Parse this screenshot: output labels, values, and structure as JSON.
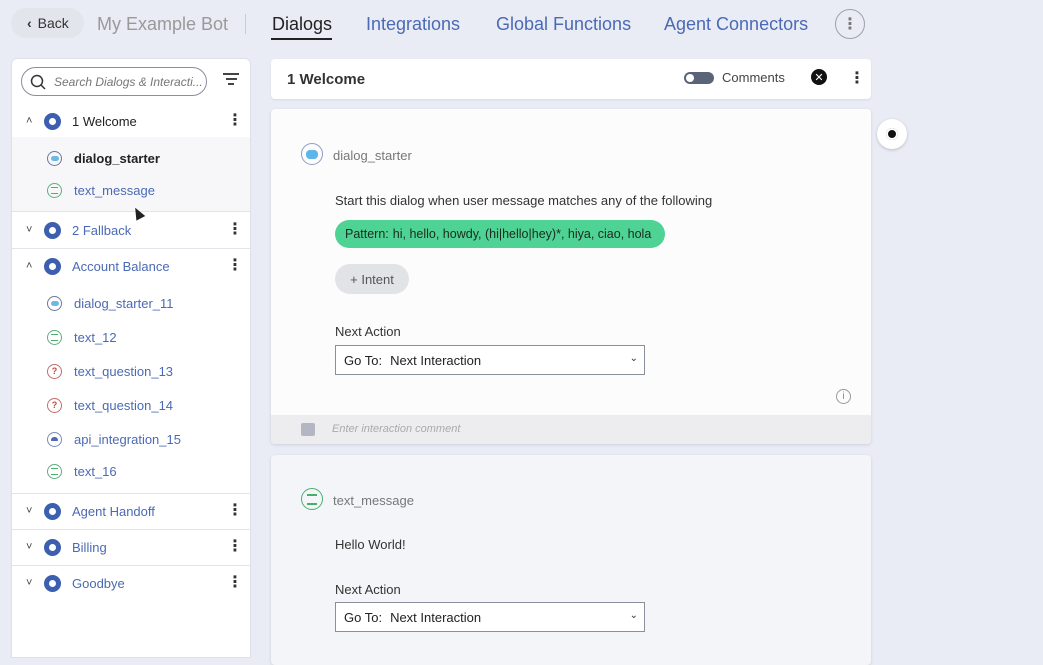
{
  "topbar": {
    "back_label": "Back",
    "bot_name": "My Example Bot",
    "tabs": [
      {
        "label": "Dialogs",
        "active": true
      },
      {
        "label": "Integrations"
      },
      {
        "label": "Global Functions"
      },
      {
        "label": "Agent Connectors"
      }
    ]
  },
  "sidebar": {
    "search_placeholder": "Search Dialogs & Interacti...",
    "groups": [
      {
        "label": "1 Welcome",
        "expanded": true,
        "selected": true,
        "items": [
          {
            "label": "dialog_starter",
            "icon": "starter-icon",
            "selected": true
          },
          {
            "label": "text_message",
            "icon": "text-icon"
          }
        ]
      },
      {
        "label": "2 Fallback",
        "expanded": false
      },
      {
        "label": "Account Balance",
        "expanded": true,
        "items": [
          {
            "label": "dialog_starter_11",
            "icon": "starter-icon"
          },
          {
            "label": "text_12",
            "icon": "text-icon"
          },
          {
            "label": "text_question_13",
            "icon": "question-icon"
          },
          {
            "label": "text_question_14",
            "icon": "question-icon"
          },
          {
            "label": "api_integration_15",
            "icon": "cloud-icon"
          },
          {
            "label": "text_16",
            "icon": "text-icon"
          }
        ]
      },
      {
        "label": "Agent Handoff",
        "expanded": false
      },
      {
        "label": "Billing",
        "expanded": false
      },
      {
        "label": "Goodbye",
        "expanded": false
      }
    ]
  },
  "main": {
    "title": "1 Welcome",
    "comments_label": "Comments",
    "comments_enabled": false,
    "cards": [
      {
        "type_name": "dialog_starter",
        "description": "Start this dialog when user message matches any of the following",
        "pattern_label": "Pattern:",
        "pattern_value": "hi, hello, howdy, (hi|hello|hey)*, hiya, ciao, hola",
        "intent_button": "+ Intent",
        "next_action_label": "Next Action",
        "goto_label": "Go To:",
        "goto_value": "Next Interaction",
        "comment_placeholder": "Enter interaction comment"
      },
      {
        "type_name": "text_message",
        "message": "Hello World!",
        "next_action_label": "Next Action",
        "goto_label": "Go To:",
        "goto_value": "Next Interaction"
      }
    ]
  },
  "colors": {
    "accent_blue": "#4a6ab5",
    "pattern_green": "#4fd394",
    "background": "#e9ecf5"
  }
}
